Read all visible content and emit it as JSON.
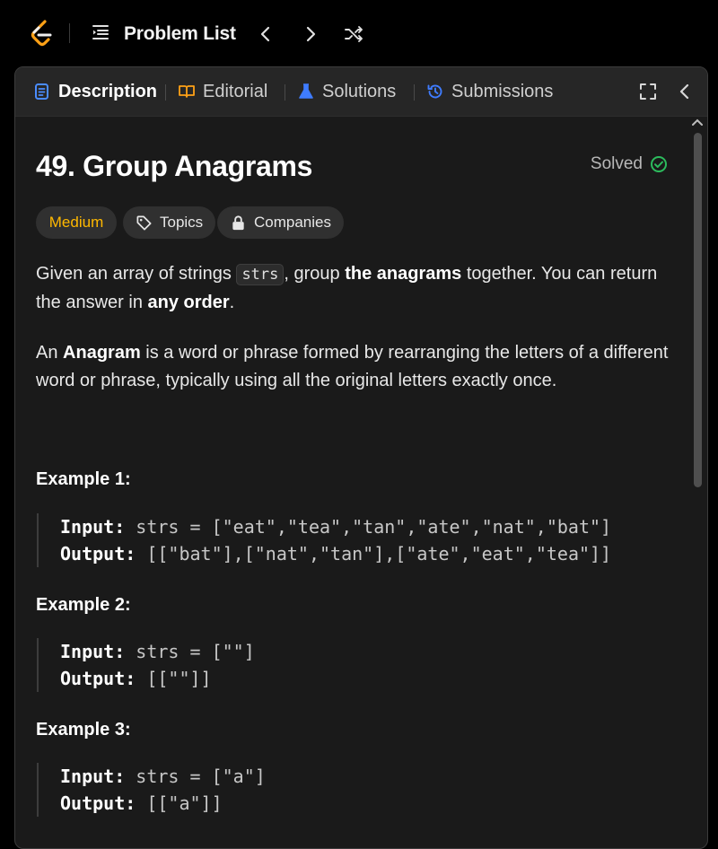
{
  "topbar": {
    "problem_list_label": "Problem List"
  },
  "tabs": [
    {
      "label": "Description"
    },
    {
      "label": "Editorial"
    },
    {
      "label": "Solutions"
    },
    {
      "label": "Submissions"
    }
  ],
  "problem": {
    "title": "49. Group Anagrams",
    "status": "Solved",
    "difficulty": "Medium",
    "topics_label": "Topics",
    "companies_label": "Companies"
  },
  "description": {
    "p1_a": "Given an array of strings ",
    "p1_code": "strs",
    "p1_b": ", group ",
    "p1_bold1": "the anagrams",
    "p1_c": " together. You can return the answer in ",
    "p1_bold2": "any order",
    "p1_d": ".",
    "p2_a": "An ",
    "p2_bold": "Anagram",
    "p2_b": " is a word or phrase formed by rearranging the letters of a different word or phrase, typically using all the original letters exactly once."
  },
  "examples": [
    {
      "title": "Example 1:",
      "input_key": "Input:",
      "input_val": " strs = [\"eat\",\"tea\",\"tan\",\"ate\",\"nat\",\"bat\"]",
      "output_key": "Output:",
      "output_val": " [[\"bat\"],[\"nat\",\"tan\"],[\"ate\",\"eat\",\"tea\"]]"
    },
    {
      "title": "Example 2:",
      "input_key": "Input:",
      "input_val": " strs = [\"\"]",
      "output_key": "Output:",
      "output_val": " [[\"\"]]"
    },
    {
      "title": "Example 3:",
      "input_key": "Input:",
      "input_val": " strs = [\"a\"]",
      "output_key": "Output:",
      "output_val": " [[\"a\"]]"
    }
  ],
  "colors": {
    "difficulty_medium": "#ffb800",
    "solved_check": "#2cbb5d",
    "description_icon": "#4a8cff",
    "editorial_icon": "#ffa116",
    "solutions_icon": "#3f7cff",
    "submissions_icon": "#3f7cff"
  }
}
